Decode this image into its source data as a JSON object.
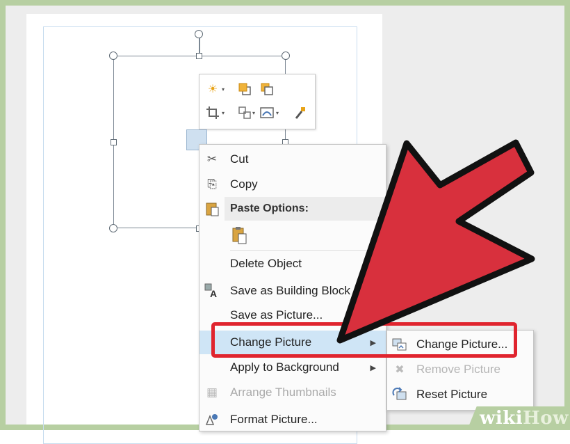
{
  "menu": {
    "cut": "Cut",
    "copy": "Copy",
    "paste_options": "Paste Options:",
    "delete_object": "Delete Object",
    "save_as_building_block": "Save as Building Block",
    "save_as_picture": "Save as Picture...",
    "change_picture": "Change Picture",
    "apply_to_background": "Apply to Background",
    "arrange_thumbnails": "Arrange Thumbnails",
    "format_picture": "Format Picture..."
  },
  "submenu": {
    "change_picture": "Change Picture...",
    "remove_picture": "Remove Picture",
    "reset_picture": "Reset Picture"
  },
  "watermark": {
    "wiki": "wiki",
    "how": "How"
  },
  "icons": {
    "brightness": "sun-icon",
    "bring_forward": "bring-forward-icon",
    "send_backward": "send-backward-icon",
    "crop": "crop-icon",
    "group": "group-icon",
    "wrap": "wrap-text-icon",
    "format_painter": "format-painter-icon"
  },
  "colors": {
    "highlight": "#e0242e",
    "arrow_fill": "#d8303d",
    "menu_hover": "#cfe5f6",
    "frame": "#b7cfa2"
  }
}
